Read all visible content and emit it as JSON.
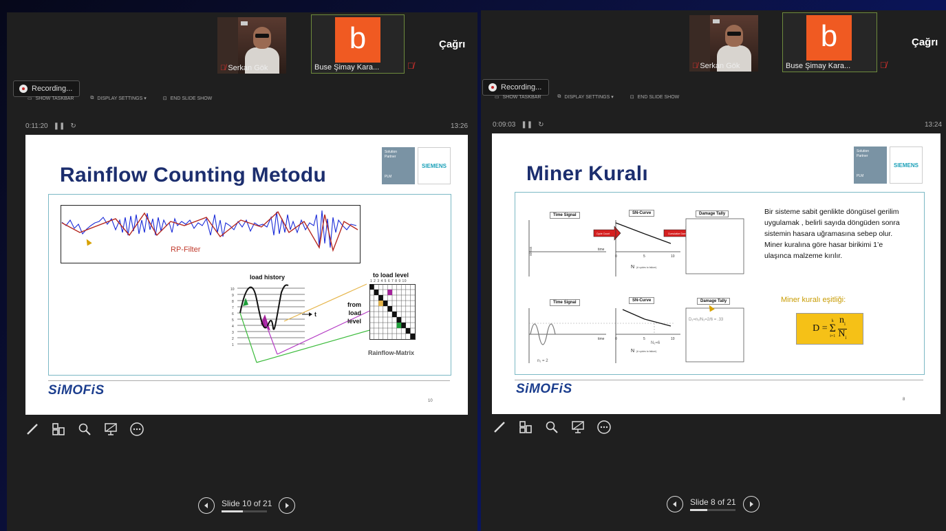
{
  "left": {
    "participants": [
      {
        "name": "Serkan Gök",
        "mic": "muted"
      },
      {
        "name": "Buse Şimay Kara...",
        "avatar_letter": "b",
        "mic": "muted"
      }
    ],
    "host_label": "Çağrı",
    "recording_label": "Recording...",
    "toolbar": {
      "show_taskbar": "SHOW TASKBAR",
      "display_settings": "DISPLAY SETTINGS ▾",
      "end_slide_show": "END SLIDE SHOW"
    },
    "timer": "0:11:20",
    "clock": "13:26",
    "slide": {
      "title": "Rainflow Counting  Metodu",
      "solution_partner": [
        "Solution",
        "Partner",
        "PLM"
      ],
      "siemens": "SIEMENS",
      "rp_filter": "RP-Filter",
      "load_history": "load history",
      "t_axis": "t",
      "to_load_level": "to load level",
      "from_load_level": [
        "from",
        "load",
        "level"
      ],
      "rainflow_matrix": "Rainflow-Matrix",
      "matrix_cols": "1 2 3 4 5 6 7 8 9 10",
      "y_ticks": [
        "10",
        "9",
        "8",
        "7",
        "6",
        "5",
        "4",
        "3",
        "2",
        "1"
      ],
      "simofis": "SiMOFiS",
      "page_number": "10"
    },
    "slide_nav": {
      "label": "Slide 10 of 21",
      "progress": 0.476
    }
  },
  "right": {
    "participants": [
      {
        "name": "Serkan Gök",
        "mic": "muted"
      },
      {
        "name": "Buse Şimay Kara...",
        "avatar_letter": "b",
        "mic": "muted"
      }
    ],
    "host_label": "Çağrı",
    "recording_label": "Recording...",
    "toolbar": {
      "show_taskbar": "SHOW TASKBAR",
      "display_settings": "DISPLAY SETTINGS ▾",
      "end_slide_show": "END SLIDE SHOW"
    },
    "timer": "0:09:03",
    "clock": "13:24",
    "slide": {
      "title": "Miner Kuralı",
      "solution_partner": [
        "Solution",
        "Partner",
        "PLM"
      ],
      "siemens": "SIEMENS",
      "time_signal": "Time Signal",
      "sn_curve": "SN-Curve",
      "damage_tally": "Damage Tally",
      "time": "time",
      "stress": "stress",
      "n_axis": "N",
      "n_axis_sub": "(# cycles to failure)",
      "sn_ticks": [
        "0",
        "5",
        "10"
      ],
      "cycle_count": "Cycle Count",
      "cumulative_damage": "Cumulative Damage",
      "n1_label": "n₁ = 2",
      "N1_label": "N₁=6",
      "damage_formula": "D₁=n₁/N₁=2/6 = .33",
      "description": "Bir sisteme sabit genlikte döngüsel gerilim uygulamak , belirli sayıda döngüden sonra sistemin hasara uğramasına sebep olur. Miner kuralına göre hasar birikimi 1’e ulaşınca malzeme kırılır.",
      "equation_title": "Miner kuralı eşitliği:",
      "equation_lhs": "D =",
      "equation_sum": "Σ",
      "equation_sum_top": "k",
      "equation_sum_bottom": "i=1",
      "equation_num": "n",
      "equation_num_sub": "i",
      "equation_den": "N",
      "equation_den_sub": "i",
      "simofis": "SiMOFiS",
      "page_number": "8"
    },
    "slide_nav": {
      "label": "Slide 8 of 21",
      "progress": 0.381
    }
  }
}
